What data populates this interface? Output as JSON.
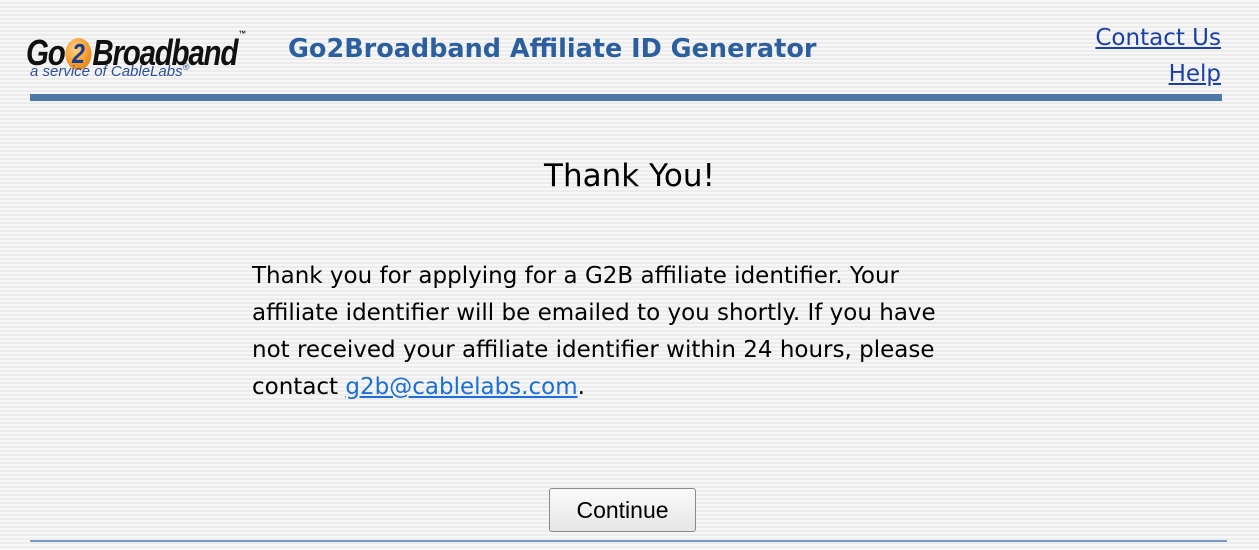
{
  "logo": {
    "brand_before": "Go",
    "brand_digit": "2",
    "brand_after": "Broadband",
    "trademark": "™",
    "tagline": "a service of CableLabs",
    "tagline_mark": "®",
    "accent_color": "#f39a2b"
  },
  "header": {
    "title": "Go2Broadband Affiliate ID Generator",
    "links": {
      "contact": "Contact Us",
      "help": "Help"
    },
    "rule_color": "#4d78a8"
  },
  "main": {
    "heading": "Thank You!",
    "message_text": "Thank you for applying for a G2B affiliate identifier. Your affiliate identifier will be emailed to you shortly. If you have not received your affiliate identifier within 24 hours, please contact ",
    "email_link": "g2b@cablelabs.com",
    "message_end": ".",
    "continue_label": "Continue"
  },
  "colors": {
    "title": "#2c5f9e",
    "link": "#1a3fa8",
    "email_link": "#1a6fd6"
  }
}
